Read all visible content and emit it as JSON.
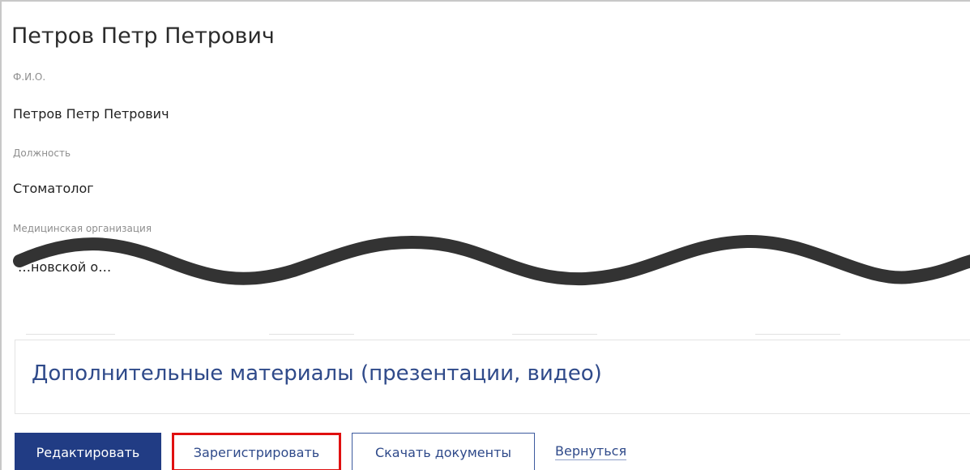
{
  "profile": {
    "heading": "Петров Петр Петрович",
    "fields": [
      {
        "label": "Ф.И.О.",
        "value": "Петров  Петр  Петрович"
      },
      {
        "label": "Должность",
        "value": "Стоматолог"
      },
      {
        "label": "Медицинская организация",
        "value": "…новской о…"
      }
    ]
  },
  "materials": {
    "title": "Дополнительные материалы (презентации, видео)"
  },
  "actions": {
    "edit_label": "Редактировать",
    "register_label": "Зарегистрировать",
    "download_label": "Скачать документы",
    "back_label": "Вернуться"
  },
  "colors": {
    "primary": "#213c84",
    "link": "#2f4a8a",
    "highlight": "#e01010",
    "redaction": "#333333"
  }
}
